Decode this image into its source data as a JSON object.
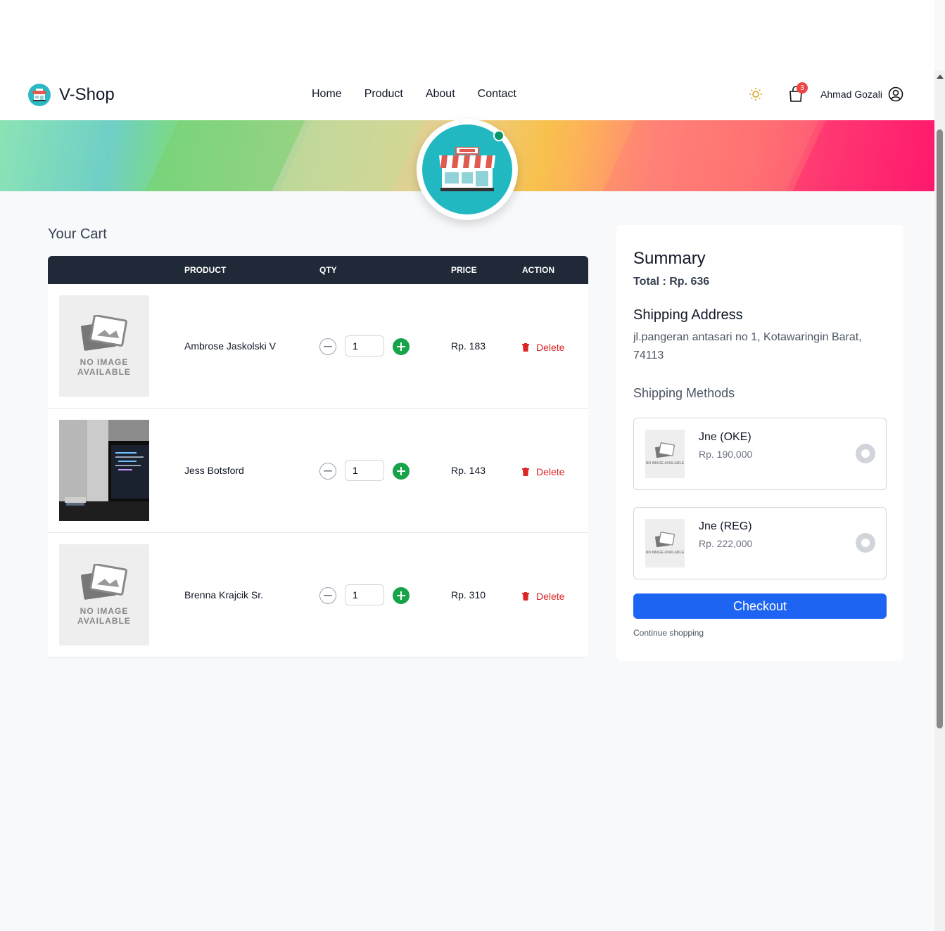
{
  "brand": {
    "name": "V-Shop"
  },
  "nav": {
    "links": [
      "Home",
      "Product",
      "About",
      "Contact"
    ]
  },
  "header": {
    "cart_count": "3",
    "user_name": "Ahmad Gozali"
  },
  "cart": {
    "title": "Your Cart",
    "columns": [
      "PRODUCT",
      "QTY",
      "PRICE",
      "ACTION"
    ],
    "no_image_text": "NO IMAGE AVAILABLE",
    "delete_label": "Delete",
    "items": [
      {
        "name": "Ambrose Jaskolski V",
        "qty": "1",
        "price": "Rp. 183",
        "image": "no-image"
      },
      {
        "name": "Jess Botsford",
        "qty": "1",
        "price": "Rp. 143",
        "image": "laptop-photo"
      },
      {
        "name": "Brenna Krajcik Sr.",
        "qty": "1",
        "price": "Rp. 310",
        "image": "no-image"
      }
    ]
  },
  "summary": {
    "title": "Summary",
    "total": "Total : Rp. 636",
    "shipping_address_title": "Shipping Address",
    "shipping_address": "jl.pangeran antasari no 1, Kotawaringin Barat, 74113",
    "shipping_methods_title": "Shipping Methods",
    "methods": [
      {
        "name": "Jne (OKE)",
        "price": "Rp. 190,000"
      },
      {
        "name": "Jne (REG)",
        "price": "Rp. 222,000"
      }
    ],
    "method_no_image_text": "NO IMAGE AVAILABLE",
    "checkout_label": "Checkout",
    "continue_label": "Continue shopping"
  },
  "colors": {
    "header_dark": "#1f2937",
    "checkout_blue": "#1d64f2",
    "delete_red": "#dc2626",
    "plus_green": "#16a34a",
    "shop_teal": "#22b8c2"
  }
}
